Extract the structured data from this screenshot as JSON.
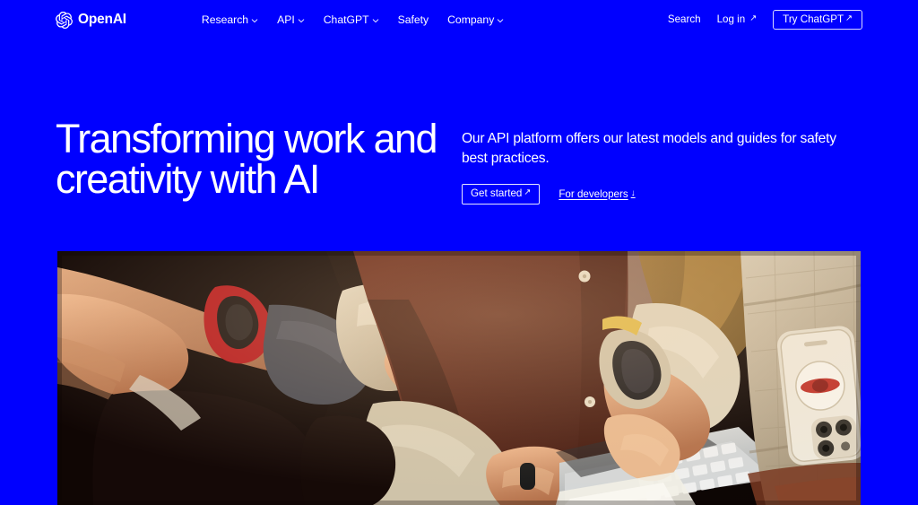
{
  "brand": {
    "name": "OpenAI",
    "logo_icon": "openai-blossom-icon"
  },
  "nav": {
    "items": [
      {
        "label": "Research",
        "has_chevron": true
      },
      {
        "label": "API",
        "has_chevron": true
      },
      {
        "label": "ChatGPT",
        "has_chevron": true
      },
      {
        "label": "Safety",
        "has_chevron": false
      },
      {
        "label": "Company",
        "has_chevron": true
      }
    ],
    "search_label": "Search",
    "login_label": "Log in",
    "login_arrow": "↗",
    "cta_label": "Try ChatGPT",
    "cta_arrow": "↗",
    "chevron_icon": "chevron-down-icon"
  },
  "hero": {
    "headline": "Transforming work and creativity with AI",
    "subheading": "Our API platform offers our latest models and guides for safety best practices.",
    "primary_cta": "Get started",
    "primary_cta_arrow": "↗",
    "secondary_cta": "For developers",
    "secondary_cta_arrow": "↓",
    "image_alt": "Three people seated close together on a couch; one types on a silver laptop while wearing a black ring, another wears a red smartwatch, a third wears a beige smartwatch, and a beige iPhone rests on the textured cushion"
  },
  "colors": {
    "background": "#0000FF",
    "text": "#FFFFFF",
    "photo_dark": "#140806",
    "photo_maroon": "#5C2418",
    "photo_skin": "#D99A72",
    "photo_beige": "#D8CBB4",
    "photo_red_watch": "#C42020",
    "photo_laptop": "#C9CBCB"
  }
}
